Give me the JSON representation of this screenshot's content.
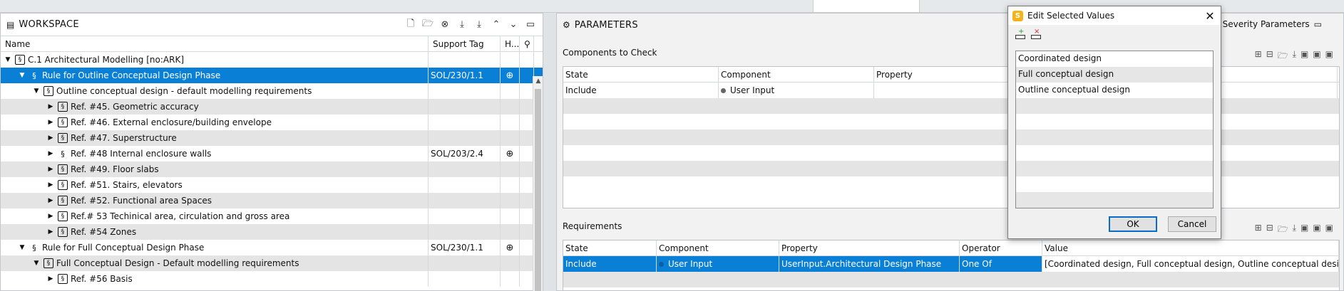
{
  "workspace": {
    "title": "WORKSPACE",
    "columns": {
      "name": "Name",
      "support_tag": "Support Tag",
      "h": "H..."
    },
    "rows": [
      {
        "depth": 0,
        "label": "C.1 Architectural Modelling [no:ARK]",
        "icon": "box",
        "tag": "",
        "h": false,
        "state": ""
      },
      {
        "depth": 1,
        "label": "Rule for Outline Conceptual Design Phase",
        "icon": "section",
        "tag": "SOL/230/1.1",
        "h": true,
        "state": "sel"
      },
      {
        "depth": 2,
        "label": "Outline conceptual design - default modelling requirements",
        "icon": "box",
        "tag": "",
        "h": false,
        "state": ""
      },
      {
        "depth": 3,
        "label": "Ref. #45. Geometric accuracy",
        "icon": "box",
        "tag": "",
        "h": false,
        "state": "alt"
      },
      {
        "depth": 3,
        "label": "Ref. #46. External enclosure/building envelope",
        "icon": "box",
        "tag": "",
        "h": false,
        "state": ""
      },
      {
        "depth": 3,
        "label": "Ref. #47. Superstructure",
        "icon": "box",
        "tag": "",
        "h": false,
        "state": "alt"
      },
      {
        "depth": 3,
        "label": "Ref. #48 Internal enclosure walls",
        "icon": "section",
        "tag": "SOL/203/2.4",
        "h": true,
        "state": ""
      },
      {
        "depth": 3,
        "label": "Ref. #49. Floor slabs",
        "icon": "box",
        "tag": "",
        "h": false,
        "state": "alt"
      },
      {
        "depth": 3,
        "label": "Ref. #51. Stairs, elevators",
        "icon": "box",
        "tag": "",
        "h": false,
        "state": ""
      },
      {
        "depth": 3,
        "label": "Ref. #52. Functional area Spaces",
        "icon": "box",
        "tag": "",
        "h": false,
        "state": "alt"
      },
      {
        "depth": 3,
        "label": "Ref.# 53 Techinical area, circulation and gross area",
        "icon": "box",
        "tag": "",
        "h": false,
        "state": ""
      },
      {
        "depth": 3,
        "label": "Ref. #54 Zones",
        "icon": "box",
        "tag": "",
        "h": false,
        "state": "alt"
      },
      {
        "depth": 1,
        "label": "Rule for Full Conceptual Design Phase",
        "icon": "section",
        "tag": "SOL/230/1.1",
        "h": true,
        "state": ""
      },
      {
        "depth": 2,
        "label": "Full Conceptual Design - Default modelling requirements",
        "icon": "box",
        "tag": "",
        "h": false,
        "state": "alt"
      },
      {
        "depth": 3,
        "label": "Ref. #56 Basis",
        "icon": "box",
        "tag": "",
        "h": false,
        "state": ""
      }
    ]
  },
  "parameters": {
    "title": "PARAMETERS",
    "severity_label": "Severity Parameters",
    "components_label": "Components to Check",
    "components_columns": [
      "State",
      "Component",
      "Property"
    ],
    "components_row": {
      "state": "Include",
      "component": "User Input",
      "property": ""
    },
    "requirements_label": "Requirements",
    "requirements_columns": [
      "State",
      "Component",
      "Property",
      "Operator",
      "Value"
    ],
    "requirements_row": {
      "state": "Include",
      "component": "User Input",
      "property": "UserInput.Architectural Design Phase",
      "operator": "One Of",
      "value": "[Coordinated design, Full conceptual design, Outline conceptual design]"
    }
  },
  "dialog": {
    "title": "Edit Selected Values",
    "items": [
      "Coordinated design",
      "Full conceptual design",
      "Outline conceptual design"
    ],
    "ok_label": "OK",
    "cancel_label": "Cancel"
  },
  "colors": {
    "selection": "#0a7fd6",
    "accent_orange": "#e0431e",
    "logo": "#f3b419"
  }
}
